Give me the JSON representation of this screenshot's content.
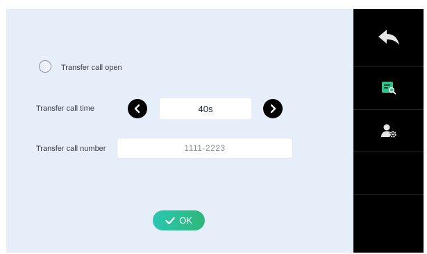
{
  "form": {
    "transfer_open_label": "Transfer call open",
    "transfer_open_checked": false,
    "transfer_time_label": "Transfer call time",
    "transfer_time_value": "40s",
    "transfer_number_label": "Transfer call number",
    "transfer_number_value": "1111-2223",
    "ok_label": "OK"
  },
  "sidebar": {
    "items": [
      {
        "icon": "back-icon"
      },
      {
        "icon": "record-search-icon"
      },
      {
        "icon": "user-settings-icon"
      }
    ]
  },
  "colors": {
    "screen_bg": "#e6eef9",
    "sidebar_bg": "#000000",
    "accent_green": "#2eb77a",
    "accent_teal": "#2bc6b3"
  }
}
